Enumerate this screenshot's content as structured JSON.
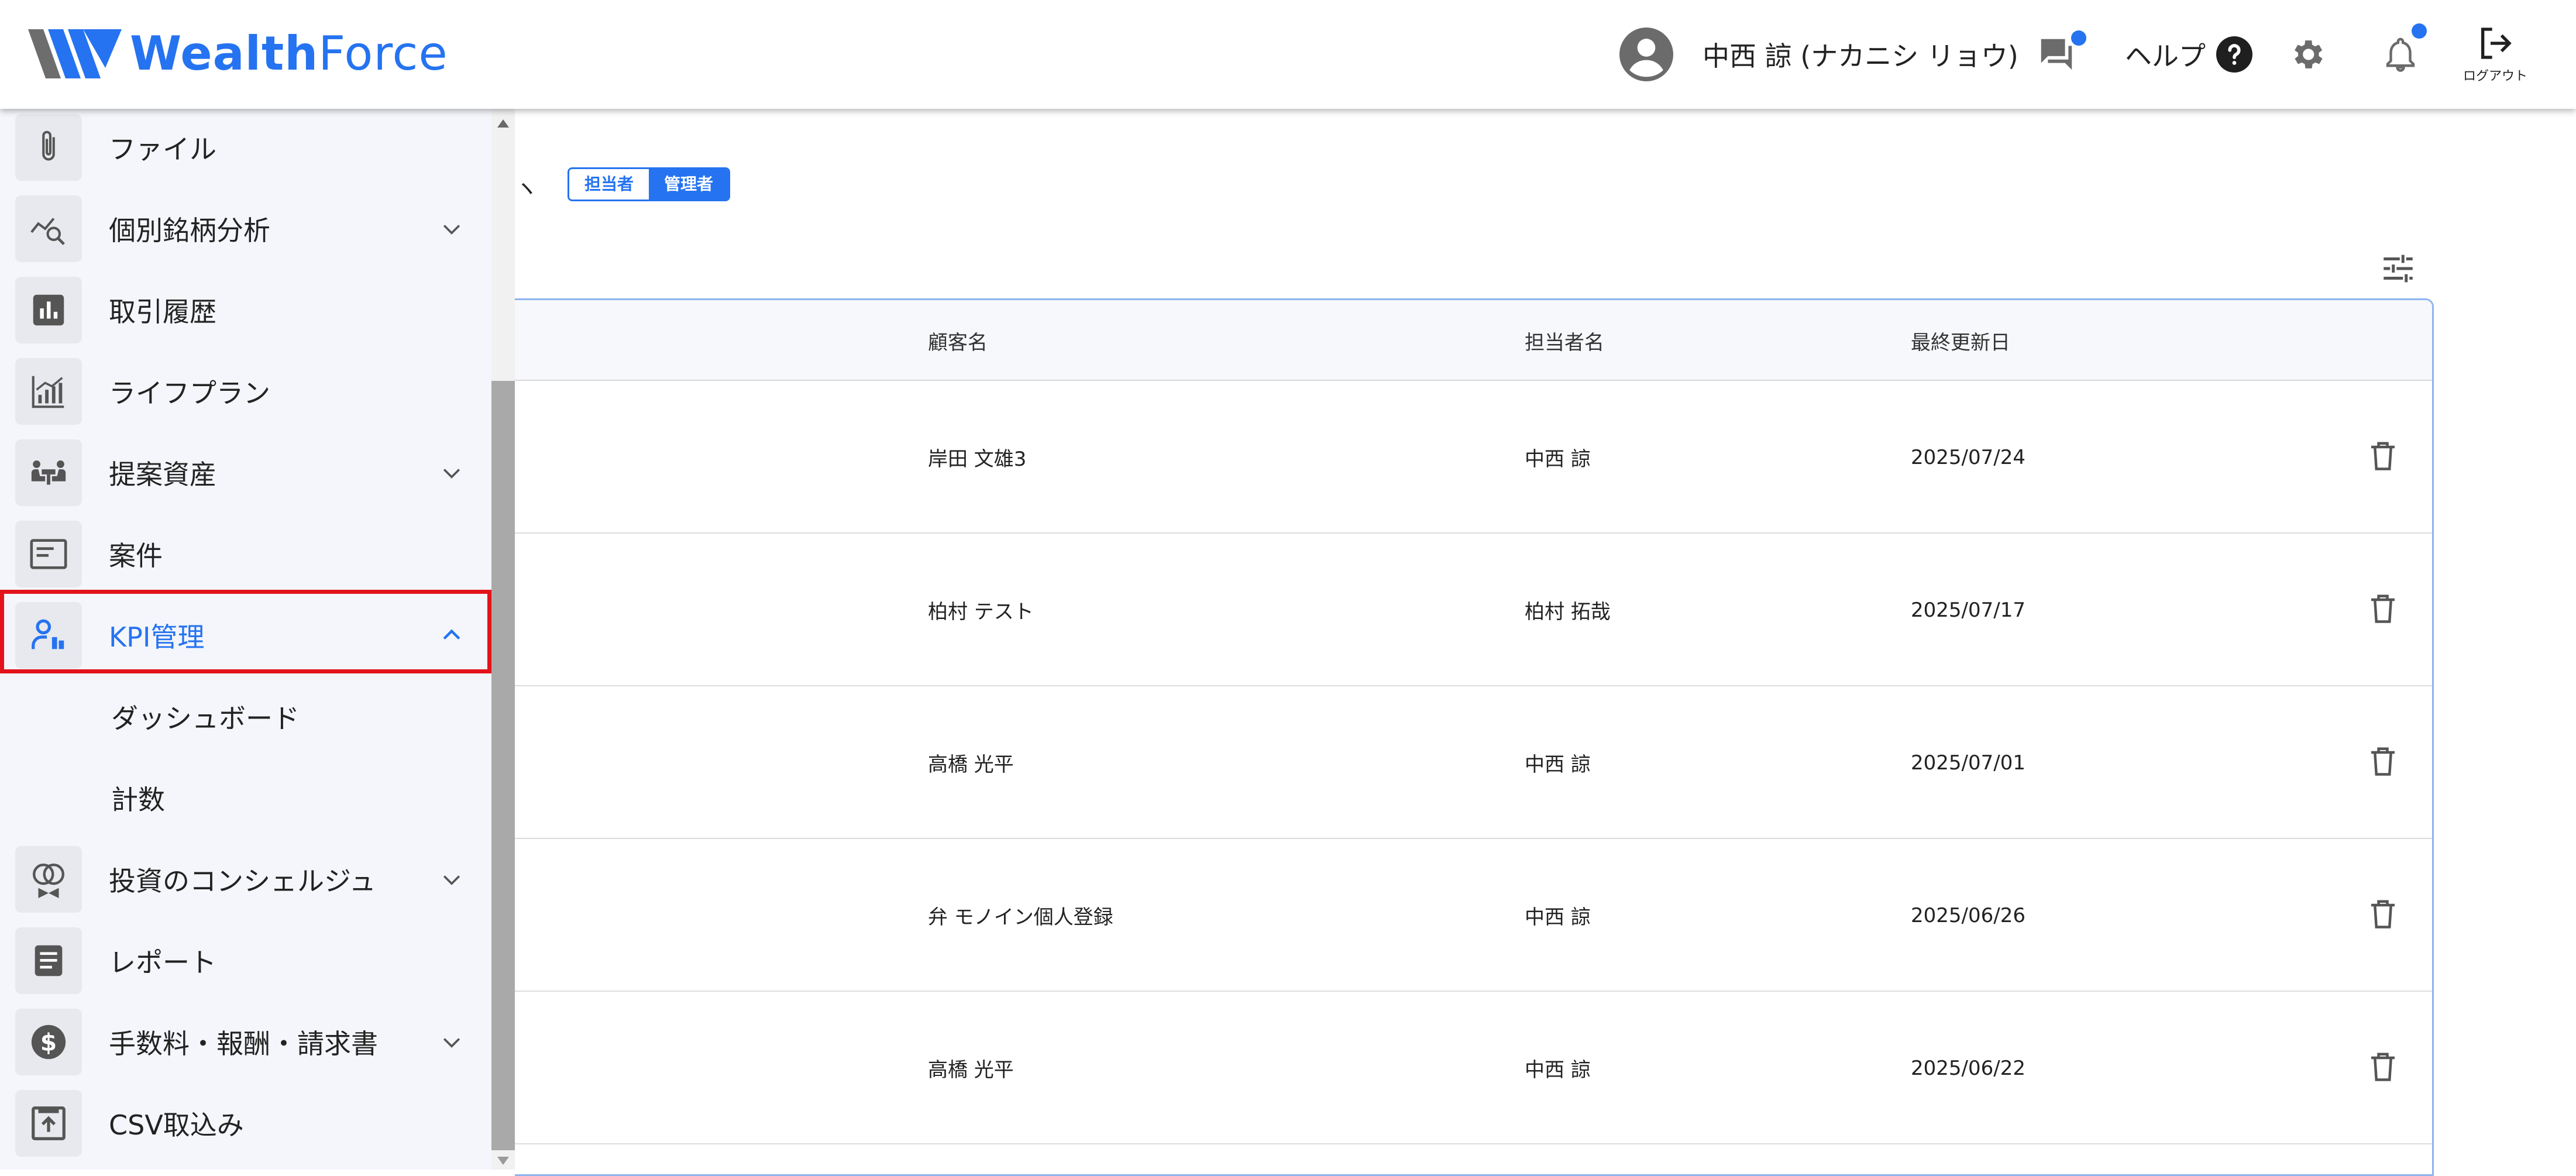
{
  "header": {
    "brand_word": "Wealth",
    "brand_word2": "Force",
    "user_name": "中西 諒 (ナカニシ リョウ)",
    "help_label": "ヘルプ",
    "logout_label": "ログアウト",
    "accent_color": "#2573f0",
    "icons": [
      "user-avatar-icon",
      "chat-icon",
      "help-icon",
      "gear-icon",
      "bell-icon",
      "logout-icon"
    ]
  },
  "sidebar": {
    "items": [
      {
        "label": "ファイル",
        "icon": "paperclip-icon"
      },
      {
        "label": "個別銘柄分析",
        "icon": "chart-search-icon",
        "expandable": true
      },
      {
        "label": "取引履歴",
        "icon": "bar-chart-icon"
      },
      {
        "label": "ライフプラン",
        "icon": "growth-chart-icon"
      },
      {
        "label": "提案資産",
        "icon": "meeting-icon",
        "expandable": true
      },
      {
        "label": "案件",
        "icon": "card-icon"
      },
      {
        "label": "KPI管理",
        "icon": "person-kpi-icon",
        "expanded": true,
        "active": true
      },
      {
        "label": "投資のコンシェルジュ",
        "icon": "rings-icon",
        "expandable": true
      },
      {
        "label": "レポート",
        "icon": "document-icon"
      },
      {
        "label": "手数料・報酬・請求書",
        "icon": "dollar-icon",
        "expandable": true
      },
      {
        "label": "CSV取込み",
        "icon": "upload-icon"
      }
    ],
    "subitems": [
      "ダッシュボード",
      "計数"
    ]
  },
  "main": {
    "peek_text": "ヽ",
    "roles": [
      "担当者",
      "管理者"
    ],
    "selected_role": "管理者",
    "table": {
      "columns": [
        "顧客名",
        "担当者名",
        "最終更新日"
      ],
      "rows": [
        [
          "岸田 文雄3",
          "中西 諒",
          "2025/07/24"
        ],
        [
          "柏村 テスト",
          "柏村 拓哉",
          "2025/07/17"
        ],
        [
          "高橋 光平",
          "中西 諒",
          "2025/07/01"
        ],
        [
          "弁 モノイン個人登録",
          "中西 諒",
          "2025/06/26"
        ],
        [
          "高橋 光平",
          "中西 諒",
          "2025/06/22"
        ]
      ]
    }
  }
}
